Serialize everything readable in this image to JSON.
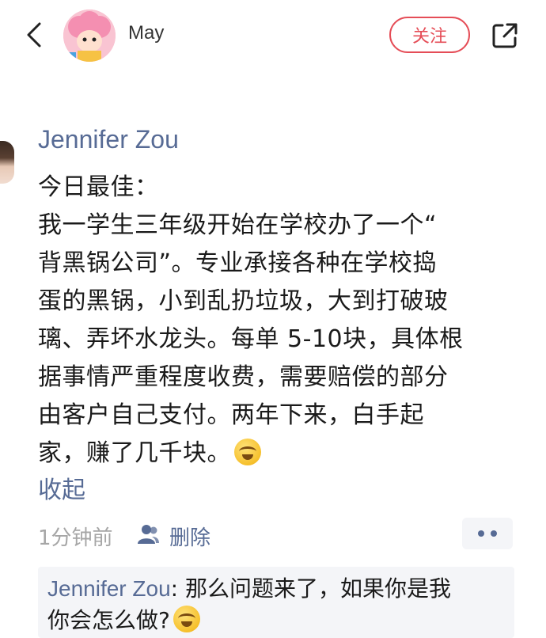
{
  "header": {
    "author_name": "May",
    "follow_label": "关注"
  },
  "post": {
    "author": "Jennifer Zou",
    "lines": [
      "今日最佳：",
      "我一学生三年级开始在学校办了一个“",
      "背黑锅公司”。专业承接各种在学校捣",
      "蛋的黑锅，小到乱扔垃圾，大到打破玻",
      "璃、弄坏水龙头。每单 5-10块，具体根",
      "据事情严重程度收费，需要赔偿的部分",
      "由客户自己支付。两年下来，白手起",
      "家，赚了几千块。"
    ],
    "emoji_icon": "facepalm-laugh-emoji",
    "collapse_label": "收起"
  },
  "meta": {
    "timestamp": "1分钟前",
    "visibility_icon": "people-icon",
    "delete_label": "删除",
    "more_icon": "more-dots-icon"
  },
  "comment": {
    "author": "Jennifer Zou",
    "separator": ": ",
    "text_line1": "那么问题来了，如果你是我",
    "text_line2": "你会怎么做?"
  },
  "colors": {
    "link_blue": "#576b95",
    "follow_red": "#e54d57",
    "meta_gray": "#a6a6a6",
    "comment_bg": "#f4f5f8"
  }
}
